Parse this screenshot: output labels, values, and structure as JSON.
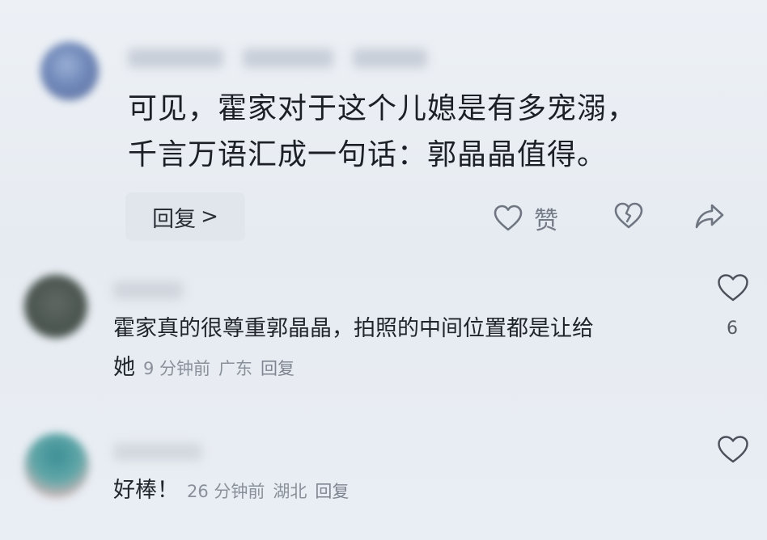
{
  "top_comment": {
    "text_lines": [
      "可见，霍家对于这个儿媳是有多宠溺，",
      "千言万语汇成一句话：郭晶晶值得。"
    ],
    "reply_label": "回复",
    "reply_chevron": ">",
    "like_label": "赞",
    "icons": [
      "heart-outline-icon",
      "broken-heart-icon",
      "share-arrow-icon"
    ]
  },
  "replies": [
    {
      "text_line1": "霍家真的很尊重郭晶晶，拍照的中间位置都是让给",
      "text_line2": "她",
      "time": "9 分钟前",
      "location": "广东",
      "reply_label": "回复",
      "like_count": "6"
    },
    {
      "text_line1": "好棒！",
      "time": "26 分钟前",
      "location": "湖北",
      "reply_label": "回复"
    }
  ],
  "colors": {
    "background": "#e8edf3",
    "text_primary": "#1b1f26",
    "text_meta": "#8a909a",
    "icon_gray": "#6f7681"
  }
}
